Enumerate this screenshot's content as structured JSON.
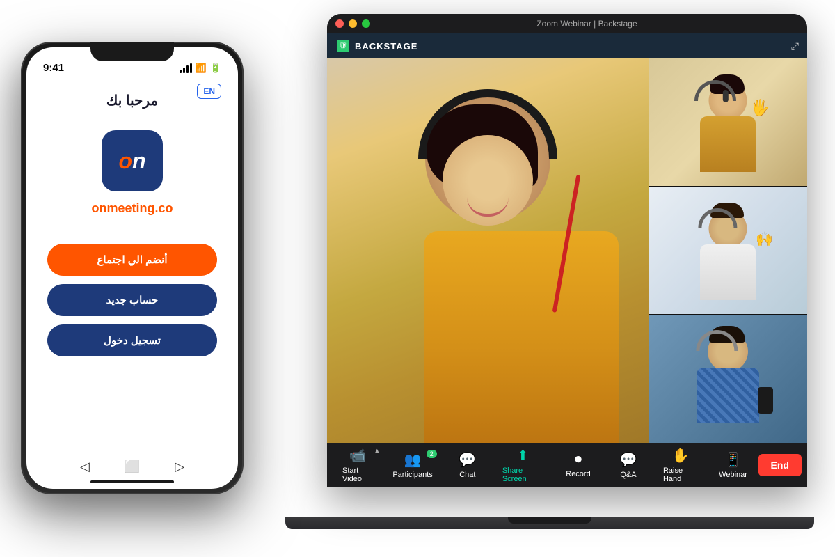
{
  "scene": {
    "bg_color": "#ffffff"
  },
  "laptop": {
    "title": "Zoom Webinar  |  Backstage",
    "backstage_label": "BACKSTAGE",
    "expand_label": "⤢",
    "toolbar_items": [
      {
        "id": "start-video",
        "icon": "📹",
        "label": "Start Video",
        "has_chevron": true,
        "muted": true
      },
      {
        "id": "participants",
        "icon": "👥",
        "label": "Participants",
        "badge": "2"
      },
      {
        "id": "chat",
        "icon": "💬",
        "label": "Chat"
      },
      {
        "id": "share-screen",
        "icon": "⬆",
        "label": "Share Screen",
        "active": true
      },
      {
        "id": "record",
        "icon": "⏺",
        "label": "Record"
      },
      {
        "id": "qa",
        "icon": "💬",
        "label": "Q&A"
      },
      {
        "id": "raise-hand",
        "icon": "✋",
        "label": "Raise Hand"
      },
      {
        "id": "webinar",
        "icon": "📱",
        "label": "Webinar"
      }
    ],
    "end_button_label": "End"
  },
  "phone": {
    "status_time": "9:41",
    "lang_button": "EN",
    "welcome_text": "مرحبا بك",
    "logo_text_on": "on",
    "app_domain": "onmeeting.co",
    "buttons": {
      "join": "أنضم الي اجتماع",
      "register": "حساب جديد",
      "login": "تسجيل دخول"
    }
  }
}
